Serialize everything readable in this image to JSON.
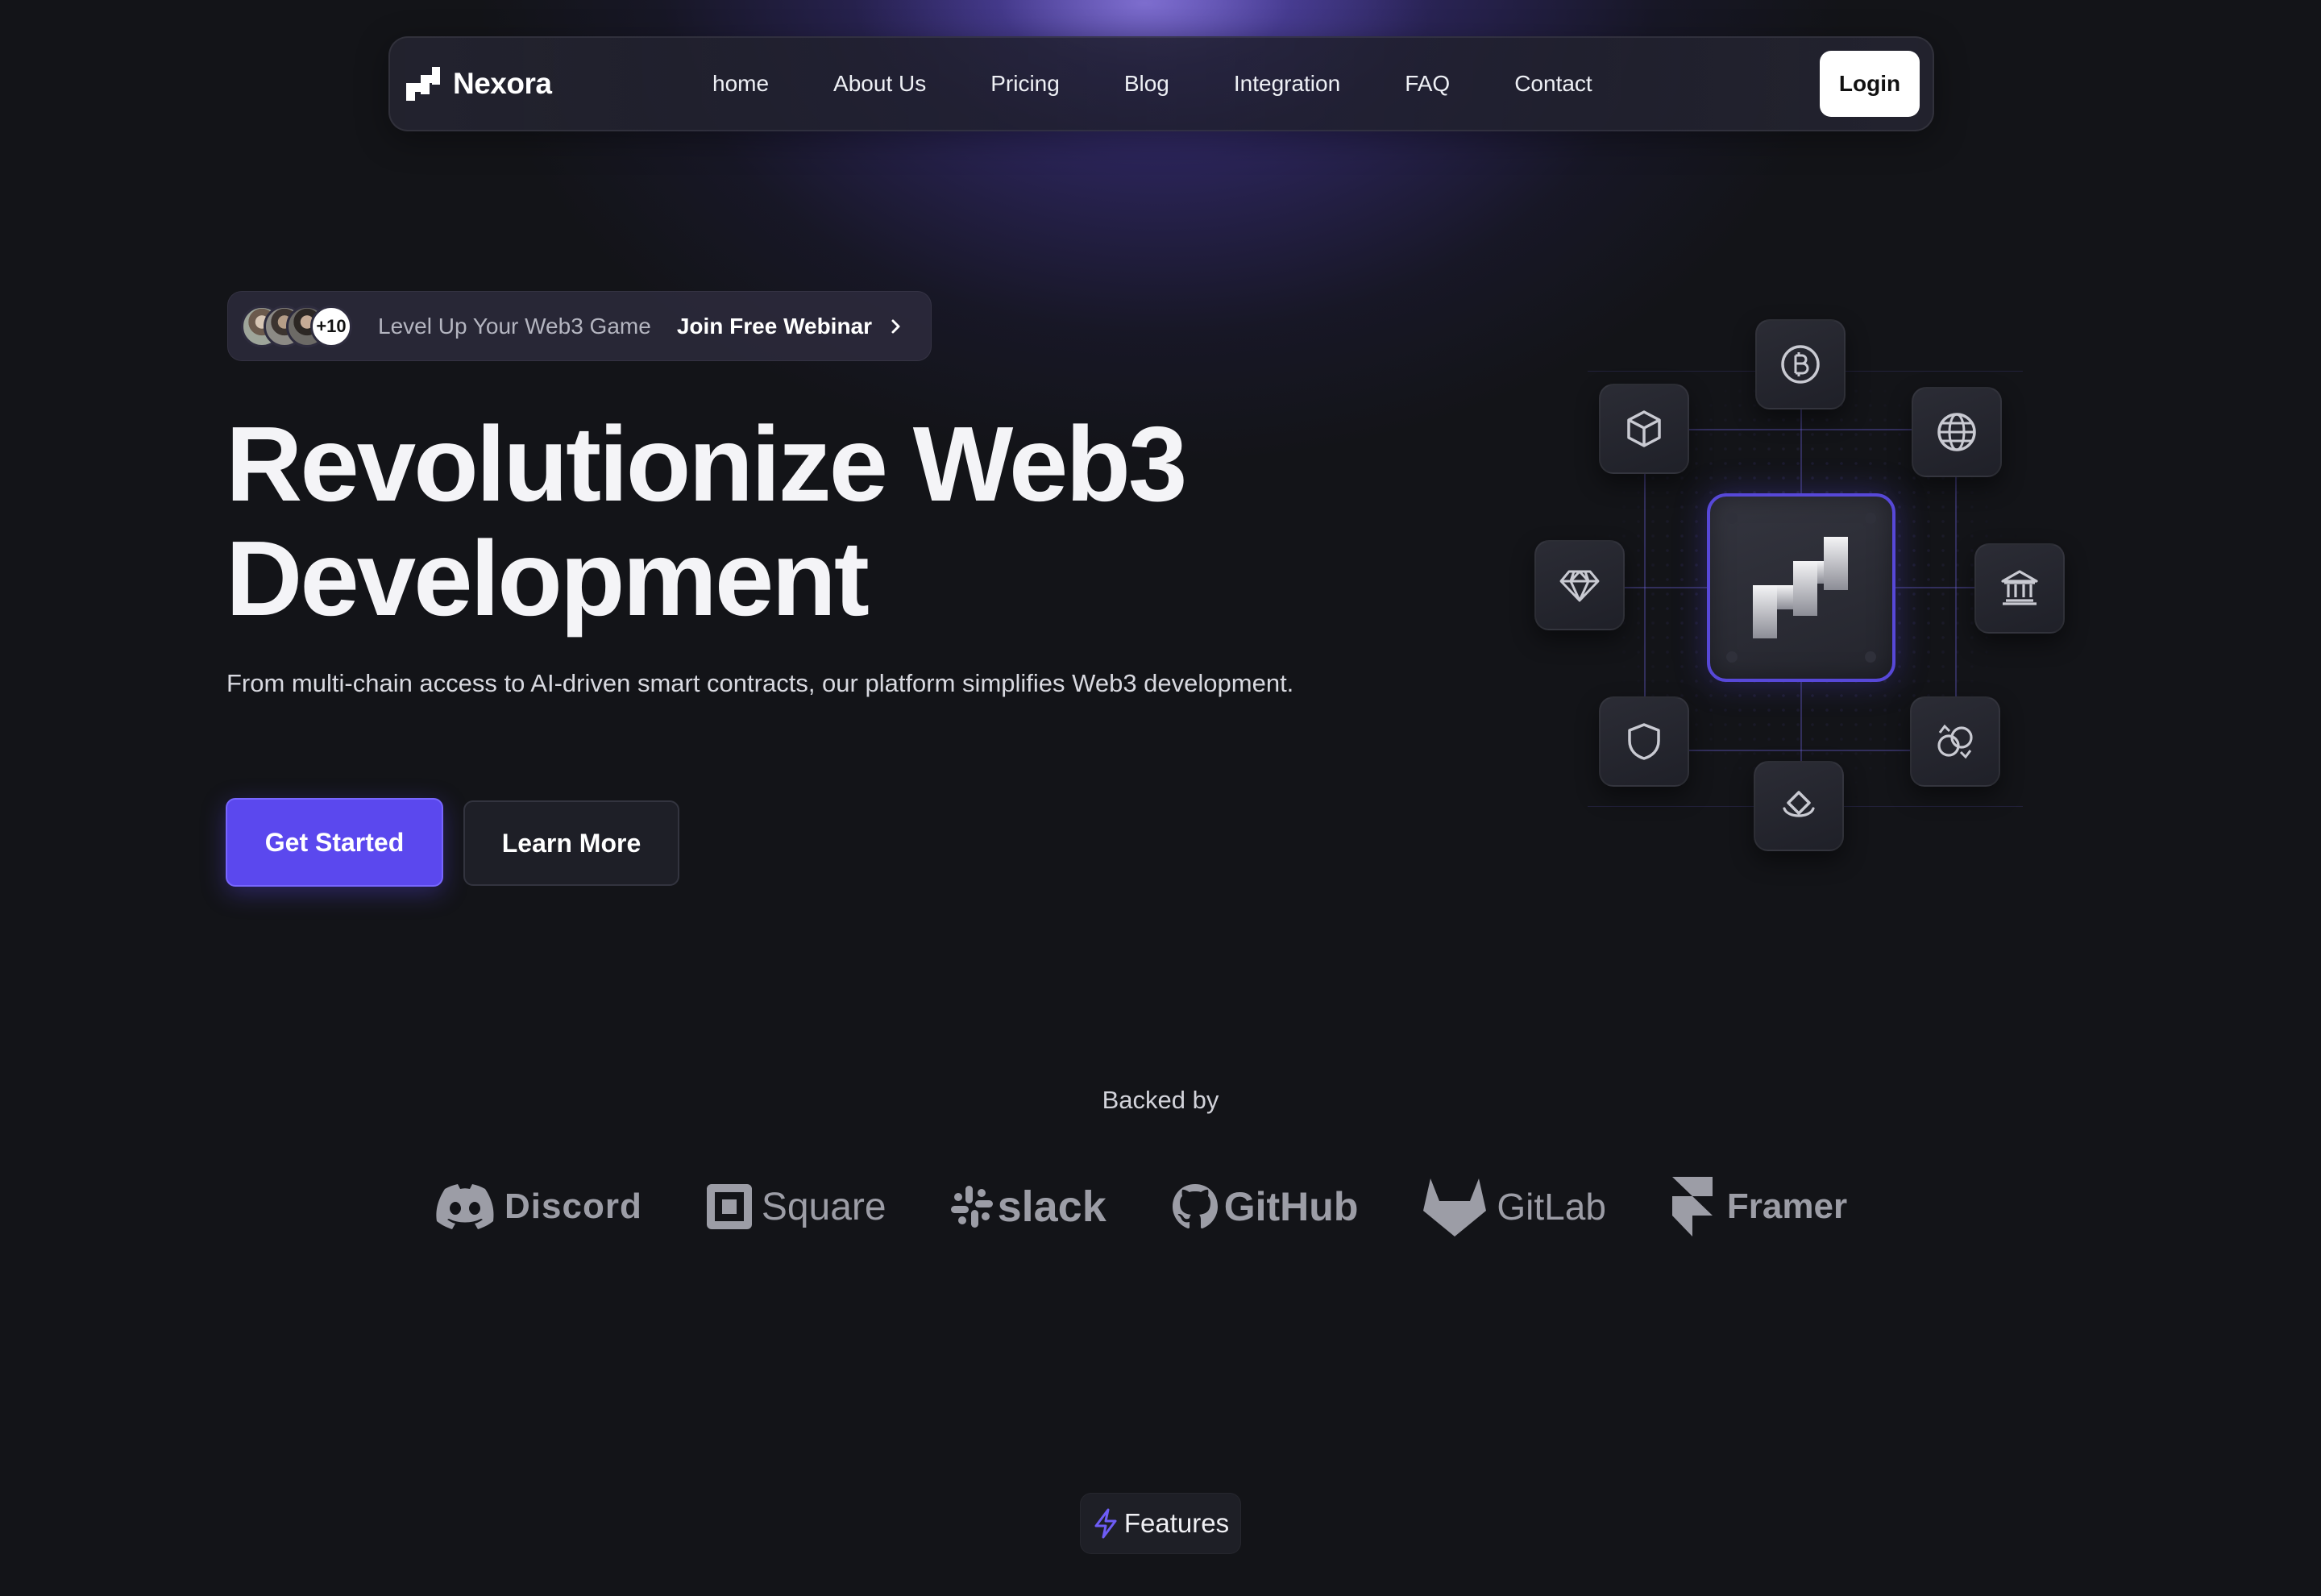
{
  "brand": {
    "name": "Nexora",
    "logo_icon": "nexora-stairs-icon"
  },
  "nav": {
    "links": [
      "home",
      "About Us",
      "Pricing",
      "Blog",
      "Integration",
      "FAQ",
      "Contact"
    ],
    "login_label": "Login"
  },
  "announcement": {
    "avatar_count_label": "+10",
    "text": "Level Up Your Web3 Game",
    "cta": "Join Free Webinar",
    "cta_icon": "chevron-right-icon"
  },
  "hero": {
    "title_line1": "Revolutionize Web3",
    "title_line2": "Development",
    "subtitle": "From multi-chain access to AI-driven smart contracts, our platform simplifies Web3 development.",
    "primary_button": "Get Started",
    "secondary_button": "Learn More"
  },
  "network_graphic": {
    "center_icon": "nexora-stairs-icon",
    "nodes": [
      "bitcoin-icon",
      "cube-icon",
      "globe-icon",
      "diamond-icon",
      "bank-icon",
      "shield-icon",
      "exchange-icon",
      "chainlink-icon"
    ]
  },
  "backed_by": {
    "title": "Backed by",
    "logos": [
      "Discord",
      "Square",
      "slack",
      "GitHub",
      "GitLab",
      "Framer"
    ]
  },
  "features_badge": {
    "label": "Features",
    "icon": "lightning-icon"
  },
  "colors": {
    "background": "#131418",
    "accent": "#5b48ee",
    "glow": "#705cf0",
    "logo_grey": "#9c9da6"
  }
}
